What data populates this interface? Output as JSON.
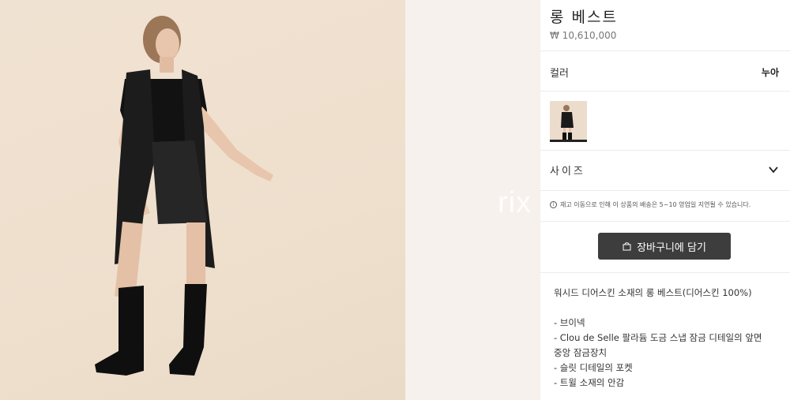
{
  "product": {
    "title": "롱 베스트",
    "price": "₩ 10,610,000"
  },
  "watermark": "rix",
  "color": {
    "label": "컬러",
    "value": "누아"
  },
  "swatch_icon": "product-thumbnail",
  "size": {
    "label": "사이즈",
    "icon": "chevron-down-icon"
  },
  "notice": "재고 이동으로 인해 이 상품의 배송은 5~10 영업일 지연될 수 있습니다.",
  "cart_button": "장바구니에 담기",
  "description": {
    "intro": "워시드 디어스킨 소재의 롱 베스트(디어스킨 100%)",
    "bullets": [
      "- 브이넥",
      "- Clou de Selle 팔라듐 도금 스냅 잠금 디테일의 앞면",
      "중앙 잠금장치",
      "- 슬릿 디테일의 포켓",
      "- 트윌 소재의 안감"
    ]
  },
  "colors": {
    "button_bg": "#3d3d3d",
    "background": "#f0e2d2"
  }
}
